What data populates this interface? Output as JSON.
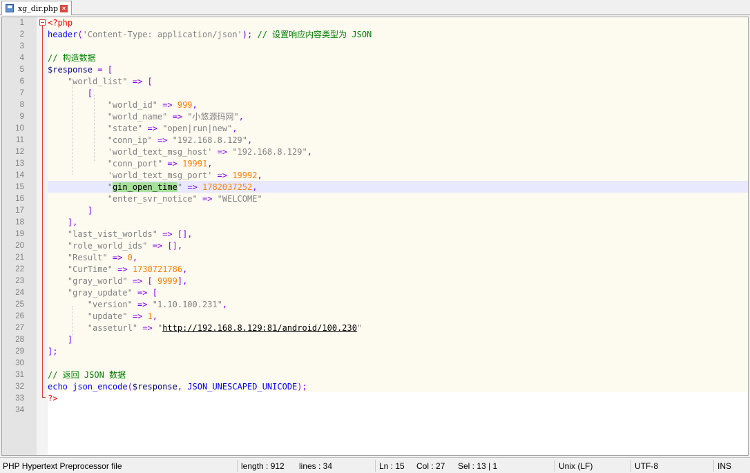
{
  "tab": {
    "filename": "xg_dir.php",
    "close": "×"
  },
  "editor": {
    "lines": [
      [
        [
          "tag",
          "<?php"
        ]
      ],
      [
        [
          "kw",
          "header"
        ],
        [
          "op",
          "("
        ],
        [
          "str",
          "'Content-Type: application/json'"
        ],
        [
          "op",
          "); "
        ],
        [
          "cm",
          "// 设置响应内容类型为 JSON"
        ]
      ],
      [],
      [
        [
          "cm",
          "// 构造数据"
        ]
      ],
      [
        [
          "var",
          "$response"
        ],
        [
          "op",
          " = ["
        ]
      ],
      [
        [
          "",
          "    "
        ],
        [
          "str",
          "\"world_list\""
        ],
        [
          "op",
          " => ["
        ]
      ],
      [
        [
          "",
          "        "
        ],
        [
          "op",
          "["
        ]
      ],
      [
        [
          "",
          "            "
        ],
        [
          "str",
          "\"world_id\""
        ],
        [
          "op",
          " => "
        ],
        [
          "num",
          "999"
        ],
        [
          "op",
          ","
        ]
      ],
      [
        [
          "",
          "            "
        ],
        [
          "str",
          "\"world_name\""
        ],
        [
          "op",
          " => "
        ],
        [
          "str",
          "\"小悠源码网\""
        ],
        [
          "op",
          ","
        ]
      ],
      [
        [
          "",
          "            "
        ],
        [
          "str",
          "\"state\""
        ],
        [
          "op",
          " => "
        ],
        [
          "str",
          "\"open|run|new\""
        ],
        [
          "op",
          ","
        ]
      ],
      [
        [
          "",
          "            "
        ],
        [
          "str",
          "\"conn_ip\""
        ],
        [
          "op",
          " => "
        ],
        [
          "str",
          "\"192.168.8.129\""
        ],
        [
          "op",
          ","
        ]
      ],
      [
        [
          "",
          "            "
        ],
        [
          "str",
          "'world_text_msg_host'"
        ],
        [
          "op",
          " => "
        ],
        [
          "str",
          "\"192.168.8.129\""
        ],
        [
          "op",
          ","
        ]
      ],
      [
        [
          "",
          "            "
        ],
        [
          "str",
          "\"conn_port\""
        ],
        [
          "op",
          " => "
        ],
        [
          "num",
          "19991"
        ],
        [
          "op",
          ","
        ]
      ],
      [
        [
          "",
          "            "
        ],
        [
          "str",
          "'world_text_msg_port'"
        ],
        [
          "op",
          " => "
        ],
        [
          "num",
          "19992"
        ],
        [
          "op",
          ","
        ]
      ],
      [
        [
          "",
          "            "
        ],
        [
          "str",
          "\""
        ],
        [
          "sel",
          "gin_open_time"
        ],
        [
          "str",
          "\""
        ],
        [
          "op",
          " => "
        ],
        [
          "num",
          "1782037252"
        ],
        [
          "op",
          ","
        ]
      ],
      [
        [
          "",
          "            "
        ],
        [
          "str",
          "\"enter_svr_notice\""
        ],
        [
          "op",
          " => "
        ],
        [
          "str",
          "\"WELCOME\""
        ]
      ],
      [
        [
          "",
          "        "
        ],
        [
          "op",
          "]"
        ]
      ],
      [
        [
          "",
          "    "
        ],
        [
          "op",
          "],"
        ]
      ],
      [
        [
          "",
          "    "
        ],
        [
          "str",
          "\"last_vist_worlds\""
        ],
        [
          "op",
          " => [],"
        ]
      ],
      [
        [
          "",
          "    "
        ],
        [
          "str",
          "\"role_world_ids\""
        ],
        [
          "op",
          " => [],"
        ]
      ],
      [
        [
          "",
          "    "
        ],
        [
          "str",
          "\"Result\""
        ],
        [
          "op",
          " => "
        ],
        [
          "num",
          "0"
        ],
        [
          "op",
          ","
        ]
      ],
      [
        [
          "",
          "    "
        ],
        [
          "str",
          "\"CurTime\""
        ],
        [
          "op",
          " => "
        ],
        [
          "num",
          "1730721786"
        ],
        [
          "op",
          ","
        ]
      ],
      [
        [
          "",
          "    "
        ],
        [
          "str",
          "\"gray_world\""
        ],
        [
          "op",
          " => [ "
        ],
        [
          "num",
          "9999"
        ],
        [
          "op",
          "],"
        ]
      ],
      [
        [
          "",
          "    "
        ],
        [
          "str",
          "\"gray_update\""
        ],
        [
          "op",
          " => ["
        ]
      ],
      [
        [
          "",
          "        "
        ],
        [
          "str",
          "\"version\""
        ],
        [
          "op",
          " => "
        ],
        [
          "str",
          "\"1.10.100.231\""
        ],
        [
          "op",
          ","
        ]
      ],
      [
        [
          "",
          "        "
        ],
        [
          "str",
          "\"update\""
        ],
        [
          "op",
          " => "
        ],
        [
          "num",
          "1"
        ],
        [
          "op",
          ","
        ]
      ],
      [
        [
          "",
          "        "
        ],
        [
          "str",
          "\"asseturl\""
        ],
        [
          "op",
          " => "
        ],
        [
          "str",
          "\""
        ],
        [
          "url",
          "http://192.168.8.129:81/android/100.230"
        ],
        [
          "str",
          "\""
        ]
      ],
      [
        [
          "",
          "    "
        ],
        [
          "op",
          "]"
        ]
      ],
      [
        [
          "op",
          "];"
        ]
      ],
      [],
      [
        [
          "cm",
          "// 返回 JSON 数据"
        ]
      ],
      [
        [
          "kw",
          "echo"
        ],
        [
          "",
          ""
        ],
        [
          "kw",
          " json_encode"
        ],
        [
          "op",
          "("
        ],
        [
          "var",
          "$response"
        ],
        [
          "op",
          ", "
        ],
        [
          "kw",
          "JSON_UNESCAPED_UNICODE"
        ],
        [
          "op",
          ");"
        ]
      ],
      [
        [
          "tag",
          "?>"
        ]
      ],
      []
    ]
  },
  "status": {
    "filetype": "PHP Hypertext Preprocessor file",
    "length": "length : 912",
    "lines": "lines : 34",
    "ln": "Ln : 15",
    "col": "Col : 27",
    "sel": "Sel : 13 | 1",
    "eol": "Unix (LF)",
    "encoding": "UTF-8",
    "mode": "INS"
  }
}
